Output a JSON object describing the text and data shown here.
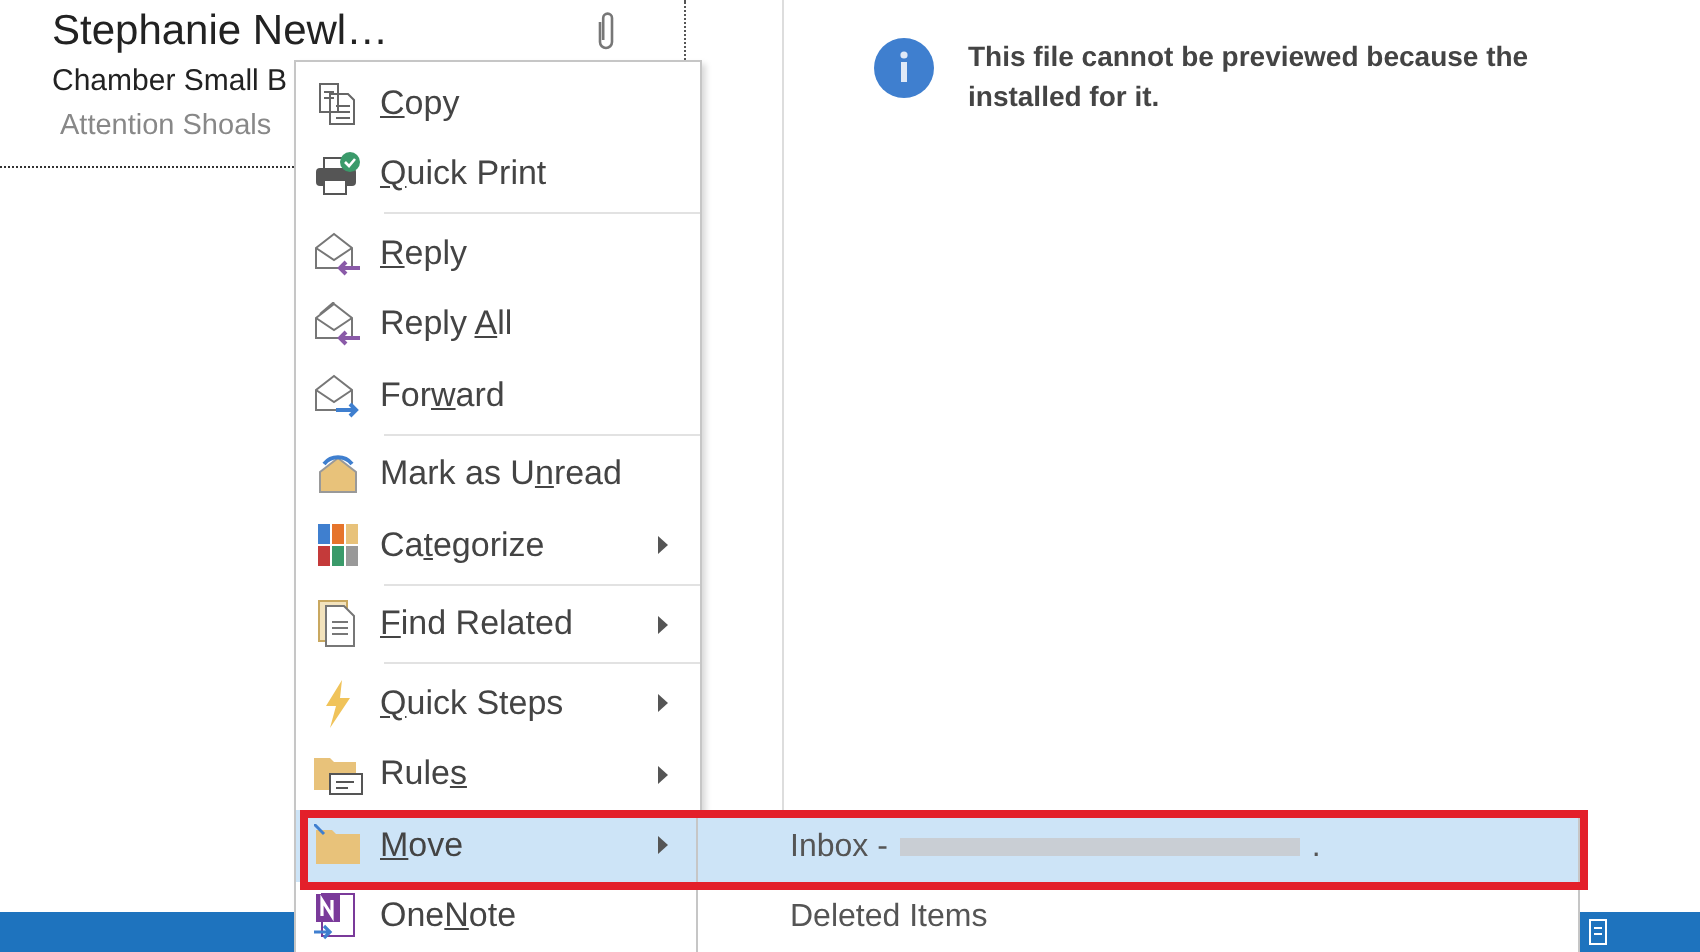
{
  "message": {
    "sender": "Stephanie Newl…",
    "subject": "Chamber Small B",
    "preview": "Attention Shoals"
  },
  "reading_pane": {
    "lines": [
      "This file cannot be previewed because the",
      "installed for it."
    ]
  },
  "context_menu": [
    {
      "kind": "item",
      "key": "C",
      "after": "opy",
      "submenu": false,
      "selected": false
    },
    {
      "kind": "item",
      "key": "Q",
      "after": "uick Print",
      "submenu": false,
      "selected": false
    },
    {
      "kind": "separator"
    },
    {
      "kind": "item",
      "key": "R",
      "after": "eply",
      "submenu": false,
      "selected": false
    },
    {
      "kind": "item",
      "before": "Reply ",
      "key": "A",
      "after": "ll",
      "submenu": false,
      "selected": false
    },
    {
      "kind": "item",
      "before": "For",
      "key": "w",
      "after": "ard",
      "submenu": false,
      "selected": false
    },
    {
      "kind": "separator"
    },
    {
      "kind": "item",
      "before": "Mark as U",
      "key": "n",
      "after": "read",
      "submenu": false,
      "selected": false
    },
    {
      "kind": "item",
      "before": "Ca",
      "key": "t",
      "after": "egorize",
      "submenu": true,
      "selected": false
    },
    {
      "kind": "separator"
    },
    {
      "kind": "item",
      "key": "F",
      "after": "ind Related",
      "submenu": true,
      "selected": false
    },
    {
      "kind": "separator"
    },
    {
      "kind": "item",
      "key": "Q",
      "after": "uick Steps",
      "submenu": true,
      "selected": false
    },
    {
      "kind": "item",
      "before": "Rule",
      "key": "s",
      "submenu": true,
      "selected": false
    },
    {
      "kind": "item",
      "key": "M",
      "after": "ove",
      "submenu": true,
      "selected": true
    },
    {
      "kind": "item",
      "before": "One",
      "key": "N",
      "after": "ote",
      "submenu": false,
      "selected": false
    }
  ],
  "submenu": [
    {
      "label": "Inbox - ",
      "redacted": true,
      "tail": ".",
      "selected": true
    },
    {
      "label": "Deleted Items",
      "redacted": false,
      "selected": false
    }
  ]
}
